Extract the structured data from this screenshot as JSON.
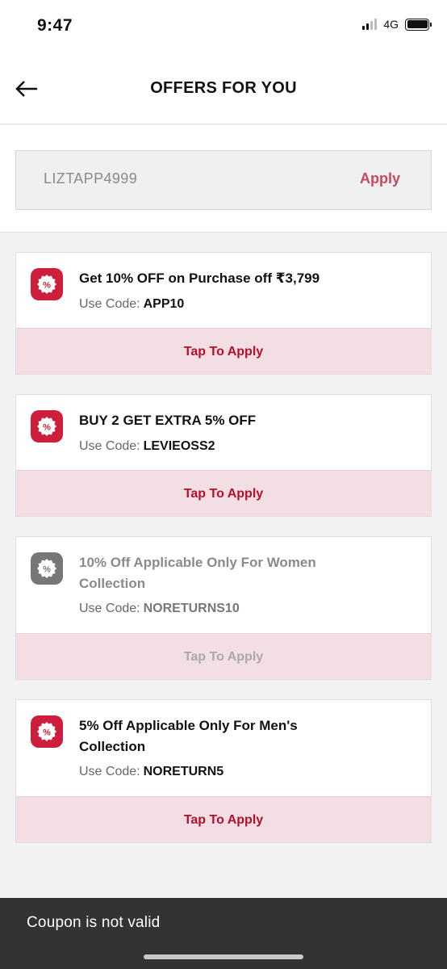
{
  "status_bar": {
    "time": "9:47",
    "network": "4G"
  },
  "header": {
    "title": "OFFERS FOR YOU",
    "back_icon": "arrow-left-icon"
  },
  "coupon": {
    "value": "LIZTAPP4999",
    "apply_label": "Apply"
  },
  "offers": [
    {
      "title": "Get 10% OFF on Purchase off ₹3,799",
      "code_label": "Use Code:",
      "code": "APP10",
      "action": "Tap To Apply",
      "enabled": true
    },
    {
      "title": "BUY 2 GET EXTRA 5% OFF",
      "code_label": "Use Code:",
      "code": "LEVIEOSS2",
      "action": "Tap To Apply",
      "enabled": true
    },
    {
      "title": "10% Off Applicable Only For Women Collection",
      "code_label": "Use Code:",
      "code": "NORETURNS10",
      "action": "Tap To Apply",
      "enabled": false
    },
    {
      "title": "5% Off Applicable Only For Men's Collection",
      "code_label": "Use Code:",
      "code": "NORETURN5",
      "action": "Tap To Apply",
      "enabled": true
    }
  ],
  "toast": {
    "message": "Coupon is not valid"
  },
  "colors": {
    "accent": "#cc1f3c",
    "apply_text": "#c64a5f",
    "tap_bg": "#f3dee3",
    "toast_bg": "#333333"
  }
}
